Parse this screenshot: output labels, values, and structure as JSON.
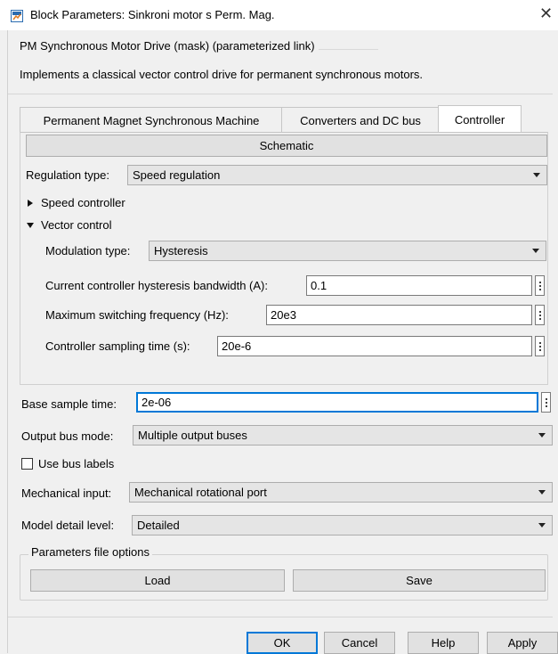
{
  "window": {
    "title": "Block Parameters: Sinkroni motor s Perm. Mag.",
    "close_glyph": "✕"
  },
  "header": {
    "mask_title": "PM Synchronous Motor Drive (mask) (parameterized link)",
    "description": "Implements a classical vector control drive for permanent synchronous motors."
  },
  "tabs": [
    {
      "label": "Permanent Magnet Synchronous Machine",
      "active": false
    },
    {
      "label": "Converters and DC bus",
      "active": false
    },
    {
      "label": "Controller",
      "active": true
    }
  ],
  "controller": {
    "schematic_label": "Schematic",
    "regulation_type": {
      "label": "Regulation type:",
      "value": "Speed regulation"
    },
    "speed_controller": {
      "label": "Speed controller",
      "expanded": false
    },
    "vector_control": {
      "label": "Vector control",
      "expanded": true
    },
    "modulation_type": {
      "label": "Modulation type:",
      "value": "Hysteresis"
    },
    "hysteresis_bandwidth": {
      "label": "Current controller hysteresis bandwidth (A):",
      "value": "0.1"
    },
    "max_switching_freq": {
      "label": "Maximum  switching frequency (Hz):",
      "value": "20e3"
    },
    "sampling_time": {
      "label": "Controller sampling time (s):",
      "value": "20e-6"
    }
  },
  "common": {
    "base_sample_time": {
      "label": "Base sample time:",
      "value": "2e-06"
    },
    "output_bus_mode": {
      "label": "Output bus mode:",
      "value": "Multiple output buses"
    },
    "use_bus_labels": {
      "label": "Use bus labels",
      "checked": false
    },
    "mechanical_input": {
      "label": "Mechanical input:",
      "value": "Mechanical rotational port"
    },
    "model_detail_level": {
      "label": "Model detail level:",
      "value": "Detailed"
    },
    "parameters_file": {
      "legend": "Parameters file options",
      "load_label": "Load",
      "save_label": "Save"
    }
  },
  "footer": {
    "ok_label": "OK",
    "cancel_label": "Cancel",
    "help_label": "Help",
    "apply_label": "Apply"
  },
  "icons": {
    "app": "simulink-block-icon",
    "close": "close-icon",
    "dropdown": "chevron-down-icon",
    "more": "kebab-menu-icon"
  },
  "colors": {
    "focus_border": "#0078d7",
    "app_icon_blue": "#2b6cb0",
    "app_icon_orange": "#e07b22"
  }
}
